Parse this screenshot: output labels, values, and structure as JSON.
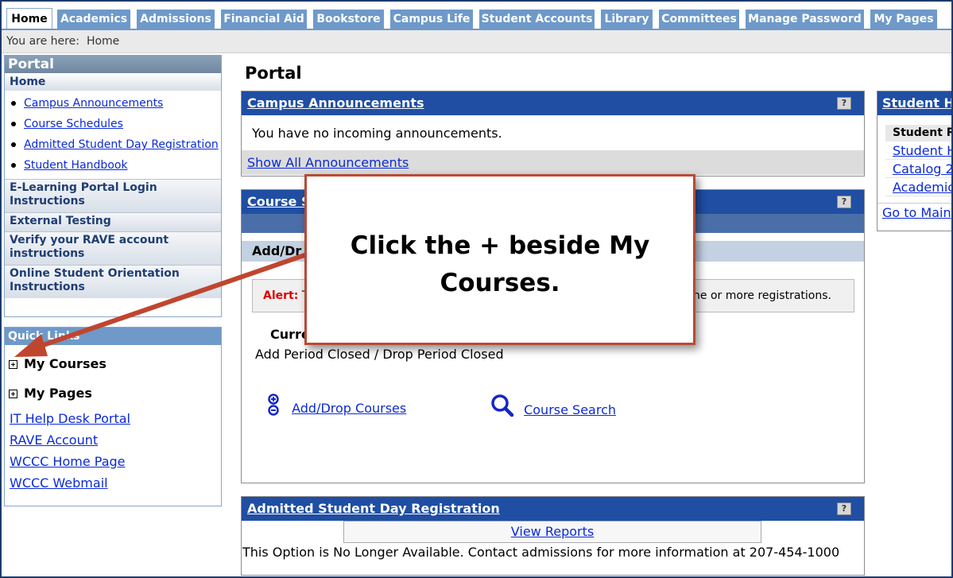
{
  "tabs": [
    "Home",
    "Academics",
    "Admissions",
    "Financial Aid",
    "Bookstore",
    "Campus Life",
    "Student Accounts",
    "Library",
    "Committees",
    "Manage Password",
    "My Pages"
  ],
  "breadcrumb": {
    "prefix": "You are here:",
    "current": "Home"
  },
  "sidebar": {
    "portal_title": "Portal",
    "home_label": "Home",
    "subitems": [
      "Campus Announcements",
      "Course Schedules",
      "Admitted Student Day Registration",
      "Student Handbook"
    ],
    "items": [
      "E-Learning Portal Login Instructions",
      "External Testing",
      "Verify your RAVE account instructions",
      "Online Student Orientation Instructions"
    ]
  },
  "quick_links": {
    "title": "Quick Links",
    "my_courses": "My Courses",
    "my_pages": "My Pages",
    "links": [
      "IT Help Desk Portal",
      "RAVE Account",
      "WCCC Home Page",
      "WCCC Webmail"
    ]
  },
  "main": {
    "title": "Portal",
    "announcements": {
      "title": "Campus Announcements",
      "help": "?",
      "message": "You have no incoming announcements.",
      "show_all": "Show All Announcements"
    },
    "course_schedules": {
      "title": "Course S",
      "help": "?",
      "adddrop_header": "Add/Dr",
      "alert_label": "Alert:",
      "alert_text_start": "T",
      "alert_text_end": "ne or more registrations.",
      "current_label": "Curre",
      "period_text": "Add Period Closed / Drop Period Closed",
      "add_drop_link": "Add/Drop Courses",
      "course_search_link": "Course Search"
    },
    "admitted_day": {
      "title": "Admitted Student Day Registration",
      "help": "?",
      "view_reports": "View Reports",
      "message": "This Option is No Longer Available. Contact admissions for more information at 207-454-1000"
    }
  },
  "student_handbook": {
    "title": "Student H",
    "label": "Student R",
    "links": [
      "Student H",
      "Catalog 2",
      "Academic"
    ],
    "goto": "Go to Main"
  },
  "callout": {
    "line1": "Click the + beside My",
    "line2": "Courses."
  },
  "colors": {
    "tab_bg": "#6e99c9",
    "panel_header": "#1f4ea3",
    "link": "#0b2ad6",
    "callout_border": "#b94a35",
    "arrow": "#c0452f",
    "alert": "#dd0000"
  }
}
